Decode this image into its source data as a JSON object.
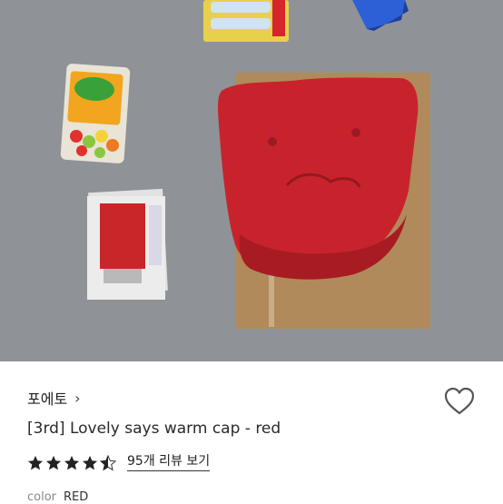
{
  "product": {
    "brand": "포에토",
    "brand_chevron": "›",
    "title": "[3rd] Lovely says warm cap - red",
    "rating_stars": 4.5,
    "review_link": "95개 리뷰 보기",
    "color_label": "color",
    "color_value": "RED"
  },
  "icons": {
    "favorite": "heart-outline-icon",
    "star": "star-icon"
  },
  "colors": {
    "cap": "#c8232c",
    "background_photo": "#8f9397",
    "star": "#222222"
  }
}
